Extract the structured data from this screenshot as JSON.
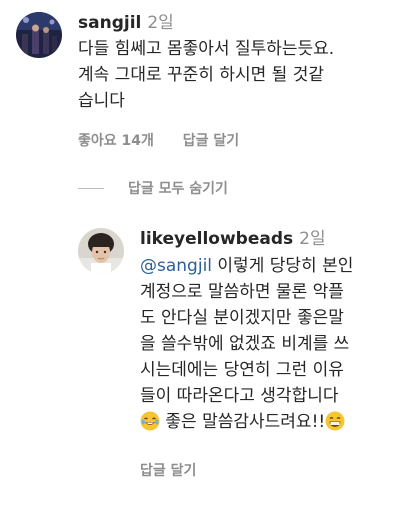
{
  "comment1": {
    "username": "sangjil",
    "time": "2일",
    "lines": [
      "다들 힘쎄고 몸좋아서 질투하는듯요.",
      "계속 그대로 꾸준히 하시면 될 것같",
      "습니다"
    ],
    "likes_label": "좋아요 14개",
    "reply_label": "답글 달기"
  },
  "hide_replies_label": "답글 모두 숨기기",
  "reply1": {
    "username": "likeyellowbeads",
    "time": "2일",
    "mention": "@sangjil",
    "line1_rest": " 이렇게 당당히 본인",
    "lines": [
      "계정으로 말씀하면 물론 악플",
      "도 안다실 분이겠지만 좋은말",
      "을 쓸수밖에 없겠죠 비계를 쓰",
      "시는데에는 당연히 그런 이유",
      "들이 따라온다고 생각합니다"
    ],
    "last_line_text": " 좋은 말씀감사드려요!!",
    "emoji_start": "laughing-tears-emoji",
    "emoji_end": "grinning-emoji",
    "reply_label": "답글 달기"
  }
}
